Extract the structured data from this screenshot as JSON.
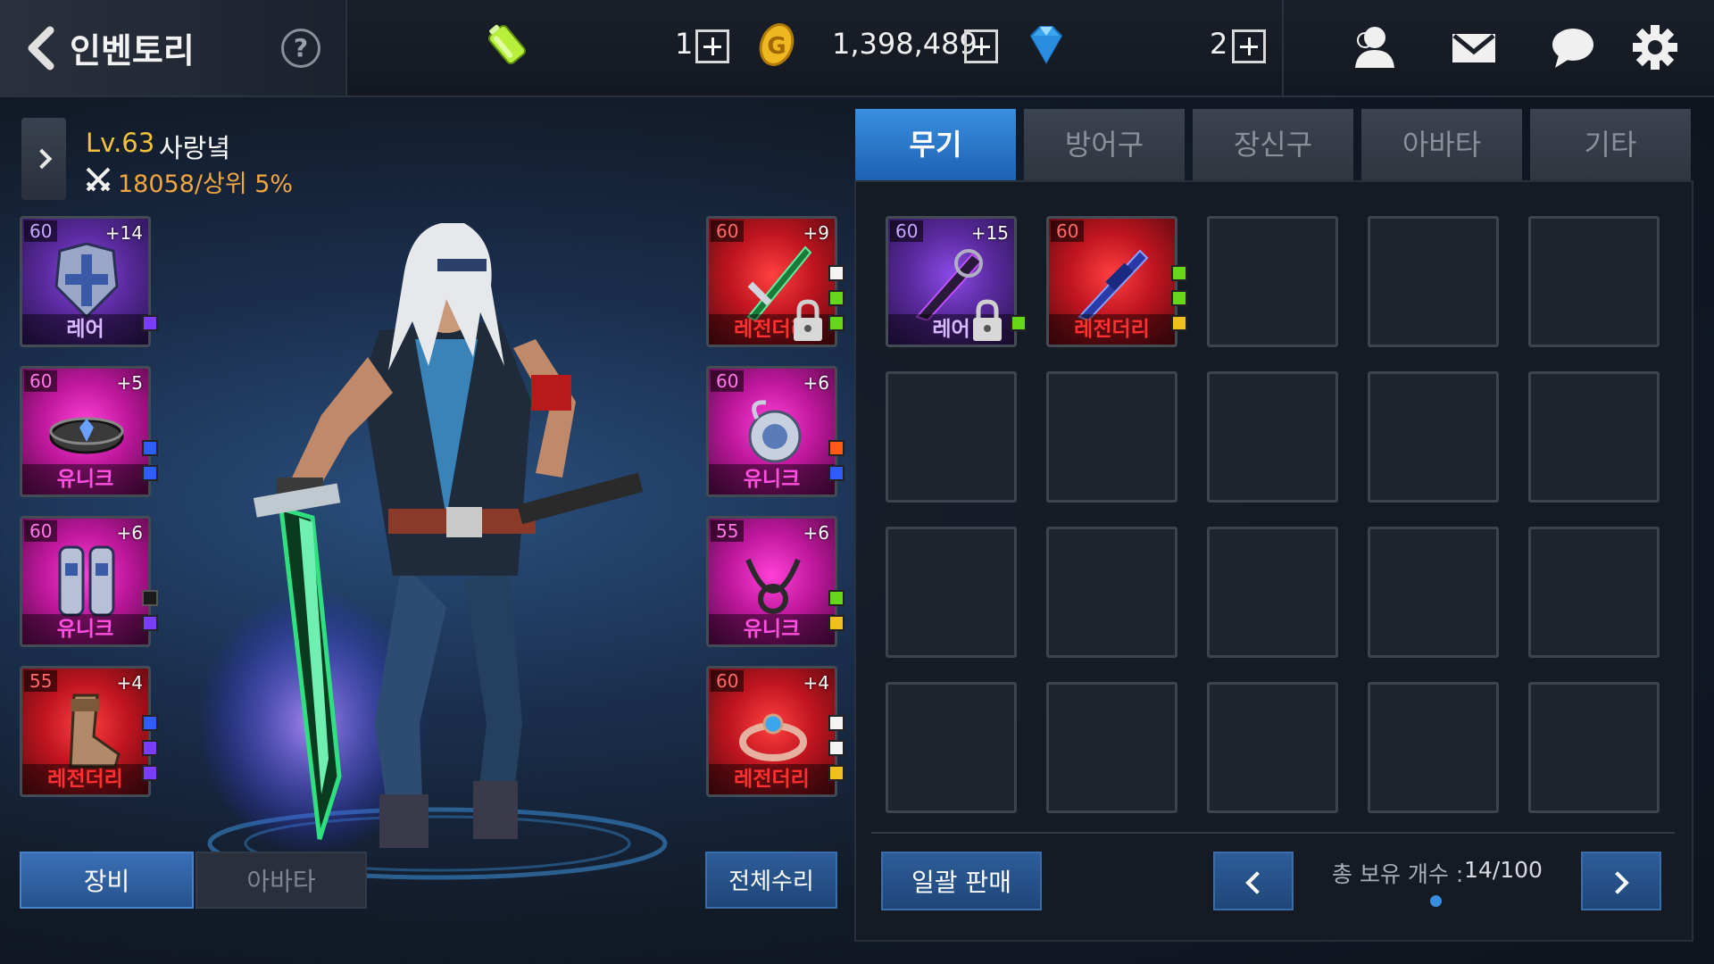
{
  "header": {
    "title": "인벤토리",
    "help_label": "?",
    "currencies": [
      {
        "icon": "battery-energy-icon",
        "value": "1"
      },
      {
        "icon": "gold-coin-icon",
        "value": "1,398,489"
      },
      {
        "icon": "blue-gem-icon",
        "value": "2"
      }
    ],
    "icons": [
      "friends-icon",
      "mail-icon",
      "chat-icon",
      "settings-gear-icon"
    ]
  },
  "character": {
    "level": "Lv.63",
    "name": "사랑녘",
    "power": "18058/상위 5%"
  },
  "equipment_left": [
    {
      "level": "60",
      "enhance": "+14",
      "grade": "레어",
      "rarity": "rare",
      "item": "chest-armor",
      "gems": [
        "purple"
      ]
    },
    {
      "level": "60",
      "enhance": "+5",
      "grade": "유니크",
      "rarity": "unique",
      "item": "belt",
      "gems": [
        "blue",
        "blue"
      ]
    },
    {
      "level": "60",
      "enhance": "+6",
      "grade": "유니크",
      "rarity": "unique",
      "item": "leg-armor",
      "gems": [
        "black",
        "purple"
      ]
    },
    {
      "level": "55",
      "enhance": "+4",
      "grade": "레전더리",
      "rarity": "legendary",
      "item": "boots",
      "gems": [
        "blue",
        "purple",
        "purple"
      ]
    }
  ],
  "equipment_right": [
    {
      "level": "60",
      "enhance": "+9",
      "grade": "레전더리",
      "rarity": "legendary",
      "item": "sword",
      "locked": true,
      "gems": [
        "white",
        "green",
        "green"
      ]
    },
    {
      "level": "60",
      "enhance": "+6",
      "grade": "유니크",
      "rarity": "unique",
      "item": "amulet",
      "gems": [
        "orange",
        "blue"
      ]
    },
    {
      "level": "55",
      "enhance": "+6",
      "grade": "유니크",
      "rarity": "unique",
      "item": "necklace",
      "gems": [
        "green",
        "yellow"
      ]
    },
    {
      "level": "60",
      "enhance": "+4",
      "grade": "레전더리",
      "rarity": "legendary",
      "item": "ring",
      "gems": [
        "white",
        "white",
        "yellow"
      ]
    }
  ],
  "buttons": {
    "equip": "장비",
    "avatar": "아바타",
    "repair_all": "전체수리",
    "bulk_sell": "일괄 판매"
  },
  "inventory": {
    "tabs": [
      "무기",
      "방어구",
      "장신구",
      "아바타",
      "기타"
    ],
    "active_tab": 0,
    "items": [
      {
        "level": "60",
        "enhance": "+15",
        "grade": "레어",
        "rarity": "rare",
        "item": "dark-blade",
        "locked": true,
        "gems": [
          "green"
        ]
      },
      {
        "level": "60",
        "enhance": "",
        "grade": "레전더리",
        "rarity": "legendary",
        "item": "blue-sword",
        "gems": [
          "green",
          "green",
          "yellow"
        ]
      }
    ],
    "grid_rows": 4,
    "grid_cols": 5,
    "count_label": "총 보유 개수 :",
    "count_value": "14/100"
  }
}
